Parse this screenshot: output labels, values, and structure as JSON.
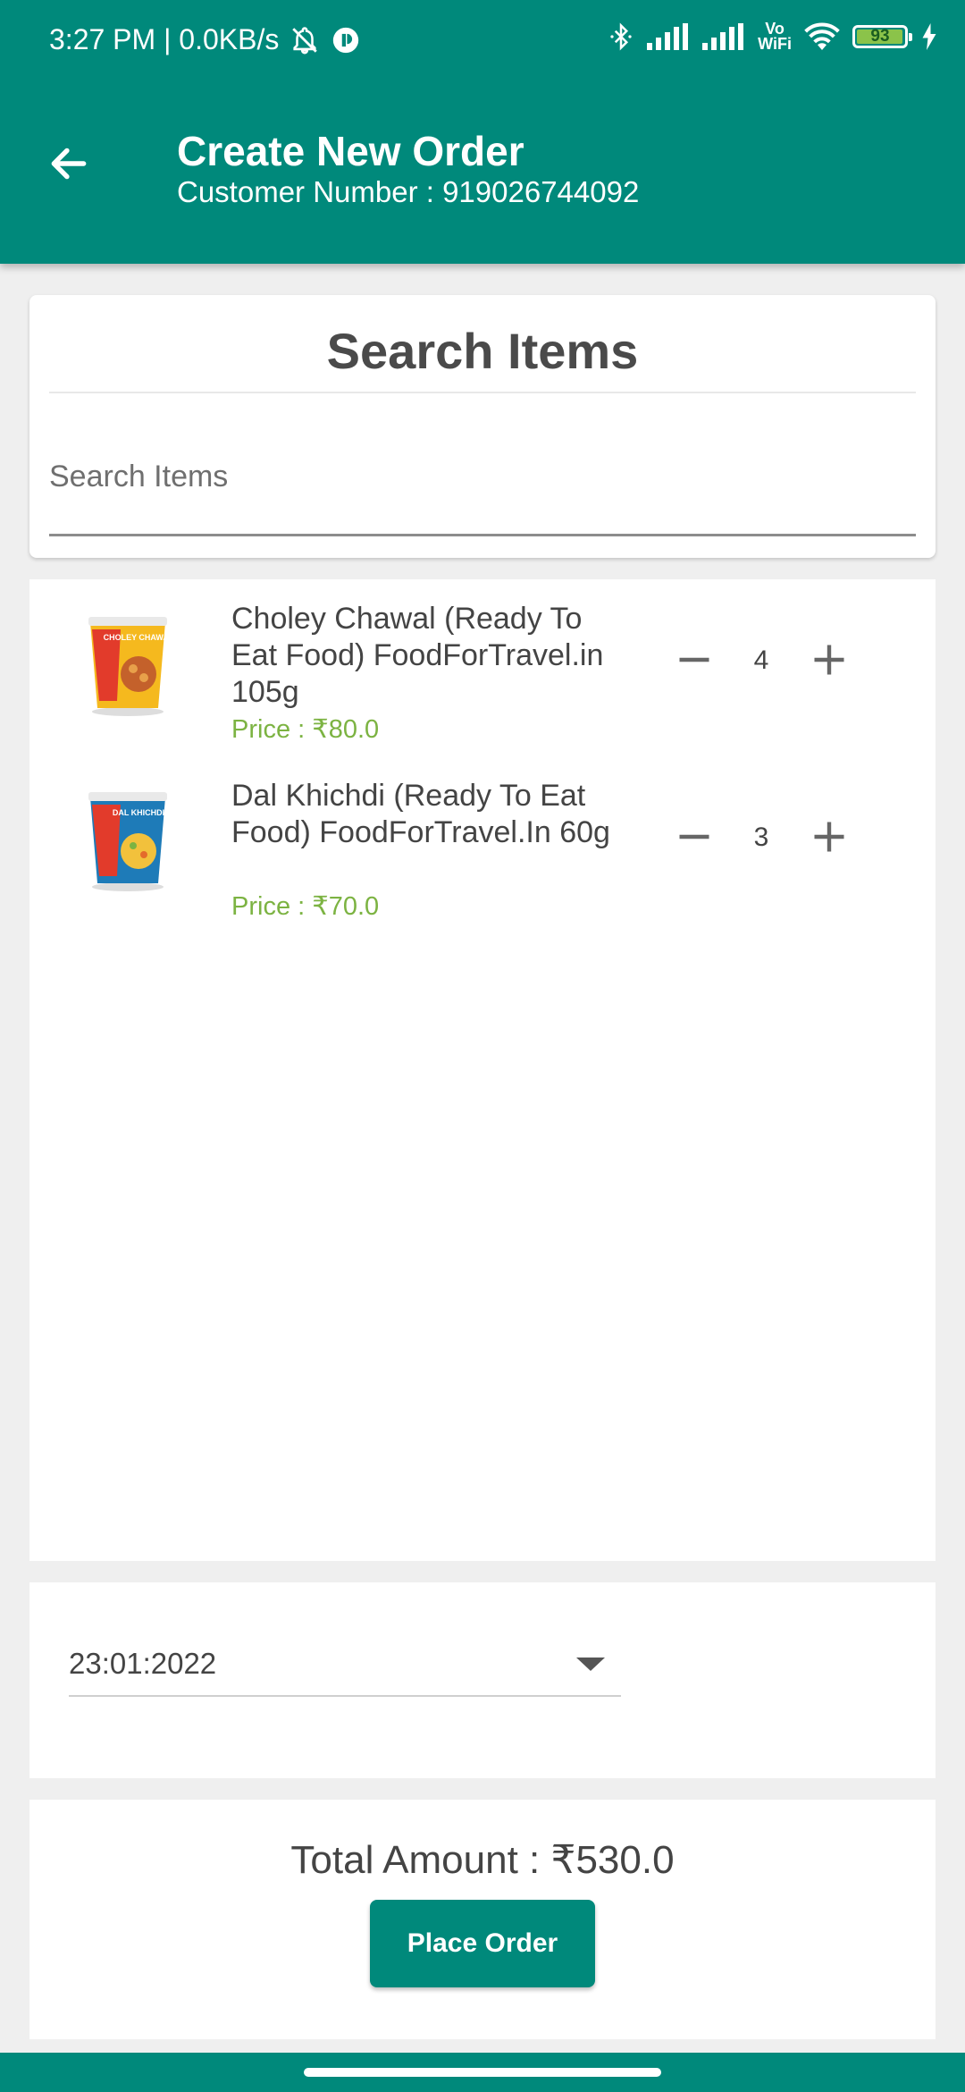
{
  "status_bar": {
    "time_speed": "3:27 PM | 0.0KB/s",
    "vowifi_top": "Vo",
    "vowifi_bottom": "WiFi",
    "battery": "93"
  },
  "header": {
    "title": "Create New Order",
    "subtitle": "Customer Number : 919026744092",
    "color": "#00897b"
  },
  "search": {
    "title": "Search Items",
    "placeholder": "Search Items",
    "value": ""
  },
  "items": [
    {
      "name": "Choley Chawal (Ready To Eat Food) FoodForTravel.in 105g",
      "price": "Price : ₹80.0",
      "quantity": "4",
      "product_label": "CHOLEY CHAWAL"
    },
    {
      "name": "Dal Khichdi (Ready To Eat Food) FoodForTravel.In 60g",
      "price": "Price : ₹70.0",
      "quantity": "3",
      "product_label": "DAL KHICHDI"
    }
  ],
  "date_select": {
    "value": "23:01:2022"
  },
  "footer": {
    "total": "Total Amount : ₹530.0",
    "place_order_label": "Place Order"
  },
  "colors": {
    "accent": "#00897b",
    "price": "#7cb342"
  },
  "icons": {
    "back": "arrow-left-icon",
    "minus": "minus-icon",
    "plus": "plus-icon",
    "dropdown": "caret-down-icon"
  }
}
